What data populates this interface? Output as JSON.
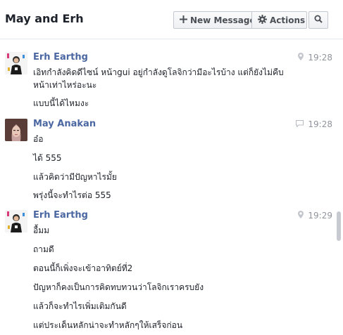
{
  "header": {
    "title": "May and Erh",
    "new_message_label": "New Message",
    "actions_label": "Actions"
  },
  "icons": {
    "plus": "plus-icon",
    "gear": "gear-icon",
    "search": "search-icon",
    "location": "location-pin-icon",
    "chat": "chat-bubble-icon"
  },
  "colors": {
    "sender_name": "#4b67a1",
    "timestamp": "#90949c"
  },
  "messages": [
    {
      "sender": "Erh Earthg",
      "time": "19:28",
      "source_icon": "location-pin-icon",
      "lines": [
        "เอิทกำลังคิดดีไซน์ หน้าgui อยู่กำลังดูโลจิกว่ามีอะไรบ้าง แต่ก็ยังไม่คืบ",
        "หน้าเท่าไหร่อะนะ",
        "แบบนี้ได้ไหมงะ"
      ]
    },
    {
      "sender": "May Anakan",
      "time": "19:28",
      "source_icon": "chat-bubble-icon",
      "lines": [
        "อ๋อ",
        "ได้ 555",
        "แล้วคิดว่ามีปัญหาไรมั้ย",
        "พรุ่งนี้จะทำไรต่อ 555"
      ]
    },
    {
      "sender": "Erh Earthg",
      "time": "19:29",
      "source_icon": "location-pin-icon",
      "lines": [
        "อื้มม",
        "ถามดี",
        "ตอนนี้ก็เพิ่งจะเข้าอาทิตย์ที่2",
        "ปัญหาก็คงเป็นการคิดทบทวนว่าโลจิกเราครบยัง",
        "แล้วก็จะทำไรเพิ่มเติมกันดี",
        "แต่ประเด็นหลักน่าจะทำหลักๆให้เสร็จก่อน"
      ]
    }
  ]
}
